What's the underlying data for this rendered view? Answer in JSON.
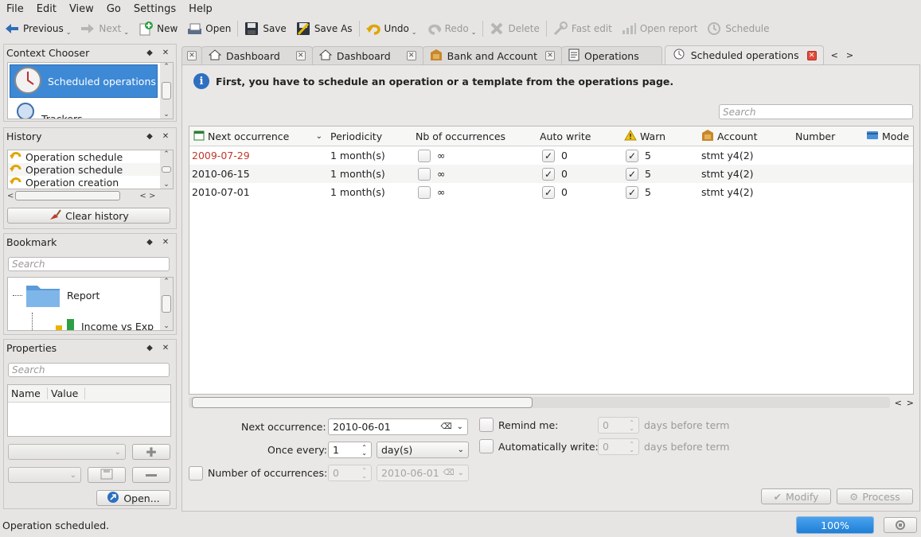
{
  "menu": [
    "File",
    "Edit",
    "View",
    "Go",
    "Settings",
    "Help"
  ],
  "toolbar": {
    "previous": "Previous",
    "next": "Next",
    "new": "New",
    "open": "Open",
    "save": "Save",
    "save_as": "Save As",
    "undo": "Undo",
    "redo": "Redo",
    "delete": "Delete",
    "fast_edit": "Fast edit",
    "open_report": "Open report",
    "schedule": "Schedule"
  },
  "context_chooser": {
    "title": "Context Chooser",
    "items": [
      "Scheduled operations",
      "Trackers"
    ]
  },
  "history": {
    "title": "History",
    "items": [
      "Operation schedule",
      "Operation schedule",
      "Operation creation"
    ],
    "clear_label": "Clear history"
  },
  "bookmark": {
    "title": "Bookmark",
    "search_placeholder": "Search",
    "tree": [
      "Report",
      "Income vs Exp"
    ]
  },
  "properties": {
    "title": "Properties",
    "search_placeholder": "Search",
    "columns": [
      "Name",
      "Value"
    ],
    "open_label": "Open..."
  },
  "tabs": [
    "Dashboard",
    "Dashboard",
    "Bank and Account",
    "Operations",
    "Scheduled operations"
  ],
  "main": {
    "info": "First, you have to schedule an operation or a template from the operations page.",
    "search_placeholder": "Search",
    "columns": [
      "Next occurrence",
      "Periodicity",
      "Nb of occurrences",
      "Auto write",
      "Warn",
      "Account",
      "Number",
      "Mode"
    ],
    "rows": [
      {
        "date": "2009-07-29",
        "periodicity": "1 month(s)",
        "nb": "∞",
        "auto": "0",
        "warn": "5",
        "account": "stmt y4(2)",
        "overdue": true
      },
      {
        "date": "2010-06-15",
        "periodicity": "1 month(s)",
        "nb": "∞",
        "auto": "0",
        "warn": "5",
        "account": "stmt y4(2)",
        "overdue": false
      },
      {
        "date": "2010-07-01",
        "periodicity": "1 month(s)",
        "nb": "∞",
        "auto": "0",
        "warn": "5",
        "account": "stmt y4(2)",
        "overdue": false
      }
    ]
  },
  "form": {
    "next_occurrence_label": "Next occurrence:",
    "next_occurrence_value": "2010-06-01",
    "once_every_label": "Once every:",
    "once_every_value": "1",
    "once_every_unit": "day(s)",
    "number_label": "Number of occurrences:",
    "number_value": "0",
    "number_date": "2010-06-01",
    "remind_label": "Remind me:",
    "remind_value": "0",
    "remind_suffix": "days before term",
    "autowrite_label": "Automatically write:",
    "autowrite_value": "0",
    "autowrite_suffix": "days before term",
    "modify_label": "Modify",
    "process_label": "Process"
  },
  "status": {
    "text": "Operation scheduled.",
    "progress": "100%",
    "progress_value": 1.0
  }
}
